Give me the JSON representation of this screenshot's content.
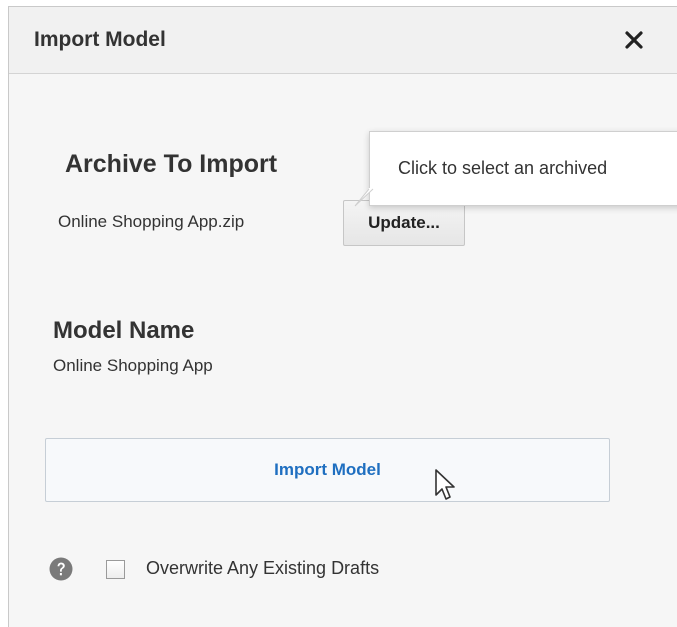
{
  "dialog": {
    "title": "Import Model",
    "close_icon": "close-icon"
  },
  "archive": {
    "heading": "Archive To Import",
    "filename": "Online Shopping App.zip",
    "update_label": "Update..."
  },
  "tooltip": {
    "text": "Click to select an archived"
  },
  "model": {
    "heading": "Model Name",
    "value": "Online Shopping App"
  },
  "actions": {
    "import_label": "Import Model"
  },
  "options": {
    "help_icon": "help-icon",
    "overwrite_label": "Overwrite Any Existing Drafts",
    "overwrite_checked": false
  },
  "colors": {
    "accent": "#1f6fc0",
    "text": "#333333",
    "dialog_bg": "#f6f6f6"
  }
}
